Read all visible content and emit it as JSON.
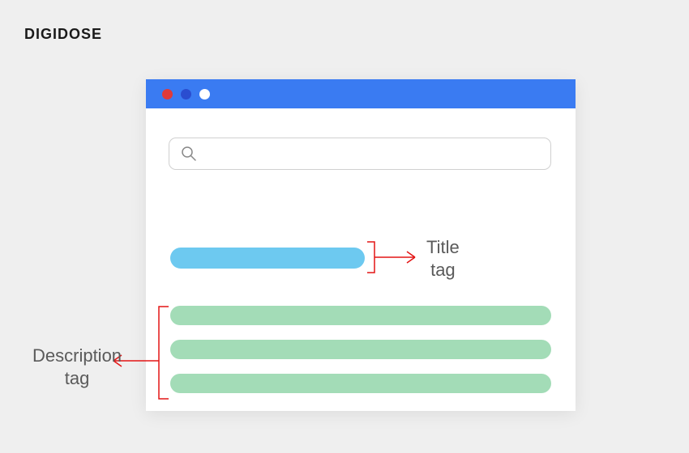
{
  "brand": "DIGIDOSE",
  "labels": {
    "title_tag": "Title\ntag",
    "description_tag": "Description\ntag"
  },
  "search": {
    "placeholder": ""
  },
  "colors": {
    "titlebar": "#3a7bf2",
    "dot_red": "#e03a3a",
    "dot_blue": "#2a4dd0",
    "title_bar_shape": "#6dc9f0",
    "description_bar_shape": "#a3dcb7",
    "arrow": "#e31515"
  }
}
